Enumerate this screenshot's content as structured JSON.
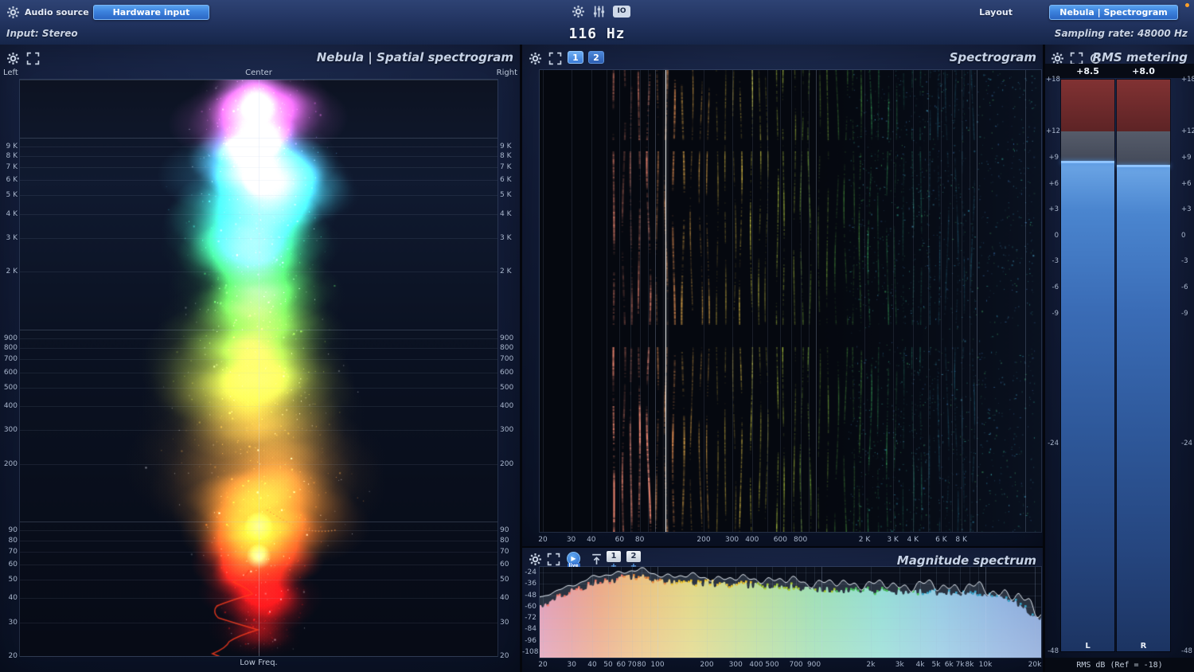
{
  "colors": {
    "accent_blue": "#3c82dd",
    "orange_dot": "#ffa028",
    "panel_title": "#c6d2e6",
    "axis_label": "#a9b6cc"
  },
  "top_bar": {
    "audio_source_label": "Audio source",
    "hardware_input_button": "Hardware input",
    "layout_label": "Layout",
    "layout_preset_button": "Nebula | Spectrogram",
    "io_icon_text": "IO"
  },
  "status_bar": {
    "input_label": "Input: Stereo",
    "frequency_readout": "116 Hz",
    "sampling_rate_label": "Sampling rate: 48000 Hz"
  },
  "panels": {
    "spatial": {
      "title": "Nebula | Spatial spectrogram",
      "left_label": "Left",
      "center_label": "Center",
      "right_label": "Right",
      "bottom_label": "Low Freq."
    },
    "spectrogram": {
      "title": "Spectrogram",
      "view_buttons": [
        "1",
        "2"
      ],
      "active_view": "1"
    },
    "magnitude": {
      "title": "Magnitude spectrum",
      "live_button": "live",
      "slot_buttons": [
        "1",
        "2"
      ],
      "add_label": "+"
    },
    "rms": {
      "title": "RMS metering",
      "footer": "RMS dB (Ref = -18)"
    }
  },
  "chart_data": [
    {
      "id": "spatial_spectrogram",
      "type": "heatmap",
      "title": "Nebula | Spatial spectrogram",
      "x_axis": {
        "left": "Left",
        "center": "Center",
        "right": "Right"
      },
      "y_scale": "log",
      "y_min_hz": 20,
      "y_max_hz": 20000,
      "y_ticks": [
        {
          "hz": 9000,
          "label": "9 K"
        },
        {
          "hz": 8000,
          "label": "8 K"
        },
        {
          "hz": 7000,
          "label": "7 K"
        },
        {
          "hz": 6000,
          "label": "6 K"
        },
        {
          "hz": 5000,
          "label": "5 K"
        },
        {
          "hz": 4000,
          "label": "4 K"
        },
        {
          "hz": 3000,
          "label": "3 K"
        },
        {
          "hz": 2000,
          "label": "2 K"
        },
        {
          "hz": 900,
          "label": "900"
        },
        {
          "hz": 800,
          "label": "800"
        },
        {
          "hz": 700,
          "label": "700"
        },
        {
          "hz": 600,
          "label": "600"
        },
        {
          "hz": 500,
          "label": "500"
        },
        {
          "hz": 400,
          "label": "400"
        },
        {
          "hz": 300,
          "label": "300"
        },
        {
          "hz": 200,
          "label": "200"
        },
        {
          "hz": 90,
          "label": "90"
        },
        {
          "hz": 80,
          "label": "80"
        },
        {
          "hz": 70,
          "label": "70"
        },
        {
          "hz": 60,
          "label": "60"
        },
        {
          "hz": 50,
          "label": "50"
        },
        {
          "hz": 40,
          "label": "40"
        },
        {
          "hz": 30,
          "label": "30"
        },
        {
          "hz": 20,
          "label": "20"
        }
      ],
      "bottom_label": "Low Freq.",
      "bands": [
        {
          "hz": 18000,
          "color": "#f48ff0",
          "hw": 40,
          "a": 0.5
        },
        {
          "hz": 15000,
          "color": "#ff5ff0",
          "hw": 55,
          "a": 0.8
        },
        {
          "hz": 12500,
          "color": "#ff70e8",
          "hw": 60,
          "a": 0.85
        },
        {
          "hz": 10500,
          "color": "#e678ff",
          "hw": 55,
          "a": 0.7
        },
        {
          "hz": 9000,
          "color": "#b086ff",
          "hw": 45,
          "a": 0.5
        },
        {
          "hz": 7800,
          "color": "#6fc4ff",
          "hw": 55,
          "a": 0.7
        },
        {
          "hz": 6800,
          "color": "#58dcff",
          "hw": 65,
          "a": 0.9
        },
        {
          "hz": 5800,
          "color": "#4ce4ff",
          "hw": 70,
          "a": 0.95
        },
        {
          "hz": 5000,
          "color": "#45e8f0",
          "hw": 70,
          "a": 0.9
        },
        {
          "hz": 4300,
          "color": "#3fe8d4",
          "hw": 68,
          "a": 0.85
        },
        {
          "hz": 3600,
          "color": "#3ce6b4",
          "hw": 66,
          "a": 0.8
        },
        {
          "hz": 3000,
          "color": "#3be290",
          "hw": 64,
          "a": 0.75
        },
        {
          "hz": 2500,
          "color": "#40e070",
          "hw": 62,
          "a": 0.7
        },
        {
          "hz": 2100,
          "color": "#48dc58",
          "hw": 62,
          "a": 0.7
        },
        {
          "hz": 1700,
          "color": "#55d84a",
          "hw": 64,
          "a": 0.65
        },
        {
          "hz": 1400,
          "color": "#66d843",
          "hw": 66,
          "a": 0.6
        },
        {
          "hz": 1150,
          "color": "#79d83e",
          "hw": 68,
          "a": 0.6
        },
        {
          "hz": 950,
          "color": "#8ed83a",
          "hw": 72,
          "a": 0.6
        },
        {
          "hz": 780,
          "color": "#a5d838",
          "hw": 76,
          "a": 0.55
        },
        {
          "hz": 640,
          "color": "#bcd836",
          "hw": 80,
          "a": 0.5
        },
        {
          "hz": 520,
          "color": "#cdd434",
          "hw": 84,
          "a": 0.45
        },
        {
          "hz": 430,
          "color": "#d8c832",
          "hw": 86,
          "a": 0.4
        },
        {
          "hz": 350,
          "color": "#d8b02e",
          "hw": 88,
          "a": 0.35
        },
        {
          "hz": 280,
          "color": "#cc9028",
          "hw": 90,
          "a": 0.3
        },
        {
          "hz": 220,
          "color": "#c07c24",
          "hw": 92,
          "a": 0.3
        },
        {
          "hz": 175,
          "color": "#cc7c20",
          "hw": 90,
          "a": 0.35
        },
        {
          "hz": 140,
          "color": "#e08420",
          "hw": 86,
          "a": 0.45
        },
        {
          "hz": 115,
          "color": "#f88e1c",
          "hw": 80,
          "a": 0.6
        },
        {
          "hz": 95,
          "color": "#ff7a14",
          "hw": 70,
          "a": 0.8
        },
        {
          "hz": 80,
          "color": "#ff5a10",
          "hw": 60,
          "a": 0.9
        },
        {
          "hz": 66,
          "color": "#ff300c",
          "hw": 55,
          "a": 0.95
        },
        {
          "hz": 55,
          "color": "#ff1808",
          "hw": 50,
          "a": 0.9
        },
        {
          "hz": 45,
          "color": "#f01008",
          "hw": 46,
          "a": 0.8
        },
        {
          "hz": 37,
          "color": "#d80c06",
          "hw": 40,
          "a": 0.7
        },
        {
          "hz": 30,
          "color": "#b00a05",
          "hw": 36,
          "a": 0.55
        },
        {
          "hz": 25,
          "color": "#8a0804",
          "hw": 30,
          "a": 0.4
        }
      ]
    },
    {
      "id": "spectrogram",
      "type": "heatmap",
      "title": "Spectrogram",
      "x_scale": "log",
      "x_min_hz": 20,
      "x_max_hz": 24000,
      "marker_hz": 116,
      "x_ticks": [
        {
          "hz": 20,
          "label": "20"
        },
        {
          "hz": 30,
          "label": "30"
        },
        {
          "hz": 40,
          "label": "40"
        },
        {
          "hz": 60,
          "label": "60"
        },
        {
          "hz": 80,
          "label": "80"
        },
        {
          "hz": 200,
          "label": "200"
        },
        {
          "hz": 300,
          "label": "300"
        },
        {
          "hz": 400,
          "label": "400"
        },
        {
          "hz": 600,
          "label": "600"
        },
        {
          "hz": 800,
          "label": "800"
        },
        {
          "hz": 2000,
          "label": "2 K"
        },
        {
          "hz": 3000,
          "label": "3 K"
        },
        {
          "hz": 4000,
          "label": "4 K"
        },
        {
          "hz": 6000,
          "label": "6 K"
        },
        {
          "hz": 8000,
          "label": "8 K"
        }
      ]
    },
    {
      "id": "magnitude_spectrum",
      "type": "area",
      "title": "Magnitude spectrum",
      "x_scale": "log",
      "x_min_hz": 20,
      "x_max_hz": 20000,
      "y_unit": "dB",
      "y_top_db": -18,
      "y_bottom_db": -114,
      "y_ticks": [
        -24,
        -36,
        -48,
        -60,
        -72,
        -84,
        -96,
        -108
      ],
      "x_ticks": [
        {
          "hz": 20,
          "label": "20"
        },
        {
          "hz": 30,
          "label": "30"
        },
        {
          "hz": 40,
          "label": "40"
        },
        {
          "hz": 50,
          "label": "50"
        },
        {
          "hz": 60,
          "label": "60"
        },
        {
          "hz": 70,
          "label": "70"
        },
        {
          "hz": 80,
          "label": "80"
        },
        {
          "hz": 100,
          "label": "100"
        },
        {
          "hz": 200,
          "label": "200"
        },
        {
          "hz": 300,
          "label": "300"
        },
        {
          "hz": 400,
          "label": "400"
        },
        {
          "hz": 500,
          "label": "500"
        },
        {
          "hz": 700,
          "label": "700"
        },
        {
          "hz": 900,
          "label": "900"
        },
        {
          "hz": 2000,
          "label": "2k"
        },
        {
          "hz": 3000,
          "label": "3k"
        },
        {
          "hz": 4000,
          "label": "4k"
        },
        {
          "hz": 5000,
          "label": "5k"
        },
        {
          "hz": 6000,
          "label": "6k"
        },
        {
          "hz": 7000,
          "label": "7k"
        },
        {
          "hz": 8000,
          "label": "8k"
        },
        {
          "hz": 10000,
          "label": "10k"
        },
        {
          "hz": 20000,
          "label": "20k"
        }
      ],
      "avg_curve_db": [
        [
          20,
          -58
        ],
        [
          25,
          -49
        ],
        [
          30,
          -44
        ],
        [
          40,
          -37
        ],
        [
          50,
          -33
        ],
        [
          60,
          -30
        ],
        [
          70,
          -29
        ],
        [
          80,
          -29
        ],
        [
          90,
          -31
        ],
        [
          100,
          -33
        ],
        [
          120,
          -34
        ],
        [
          150,
          -35
        ],
        [
          200,
          -36
        ],
        [
          250,
          -37
        ],
        [
          300,
          -38
        ],
        [
          400,
          -37
        ],
        [
          500,
          -39
        ],
        [
          600,
          -40
        ],
        [
          700,
          -39
        ],
        [
          800,
          -41
        ],
        [
          1000,
          -42
        ],
        [
          1300,
          -43
        ],
        [
          1600,
          -42
        ],
        [
          2000,
          -44
        ],
        [
          2500,
          -44
        ],
        [
          3000,
          -45
        ],
        [
          4000,
          -44
        ],
        [
          5000,
          -46
        ],
        [
          6000,
          -45
        ],
        [
          8000,
          -47
        ],
        [
          10000,
          -49
        ],
        [
          13000,
          -52
        ],
        [
          16000,
          -57
        ],
        [
          20000,
          -72
        ]
      ]
    },
    {
      "id": "rms_meters",
      "type": "bar",
      "title": "RMS metering",
      "scale_db": {
        "top": 18,
        "bottom": -48
      },
      "over_zone_db": 12,
      "reference_db": -18,
      "ticks": [
        {
          "db": 18,
          "label": "+18"
        },
        {
          "db": 12,
          "label": "+12"
        },
        {
          "db": 9,
          "label": "+9"
        },
        {
          "db": 6,
          "label": "+6"
        },
        {
          "db": 3,
          "label": "+3"
        },
        {
          "db": 0,
          "label": "0"
        },
        {
          "db": -3,
          "label": "-3"
        },
        {
          "db": -6,
          "label": "-6"
        },
        {
          "db": -9,
          "label": "-9"
        },
        {
          "db": -24,
          "label": "-24"
        },
        {
          "db": -48,
          "label": "-48"
        }
      ],
      "meters": [
        {
          "channel": "L",
          "rms_db": 8.5,
          "label": "+8.5"
        },
        {
          "channel": "R",
          "rms_db": 8.0,
          "label": "+8.0"
        }
      ],
      "footer": "RMS dB (Ref = -18)"
    }
  ]
}
